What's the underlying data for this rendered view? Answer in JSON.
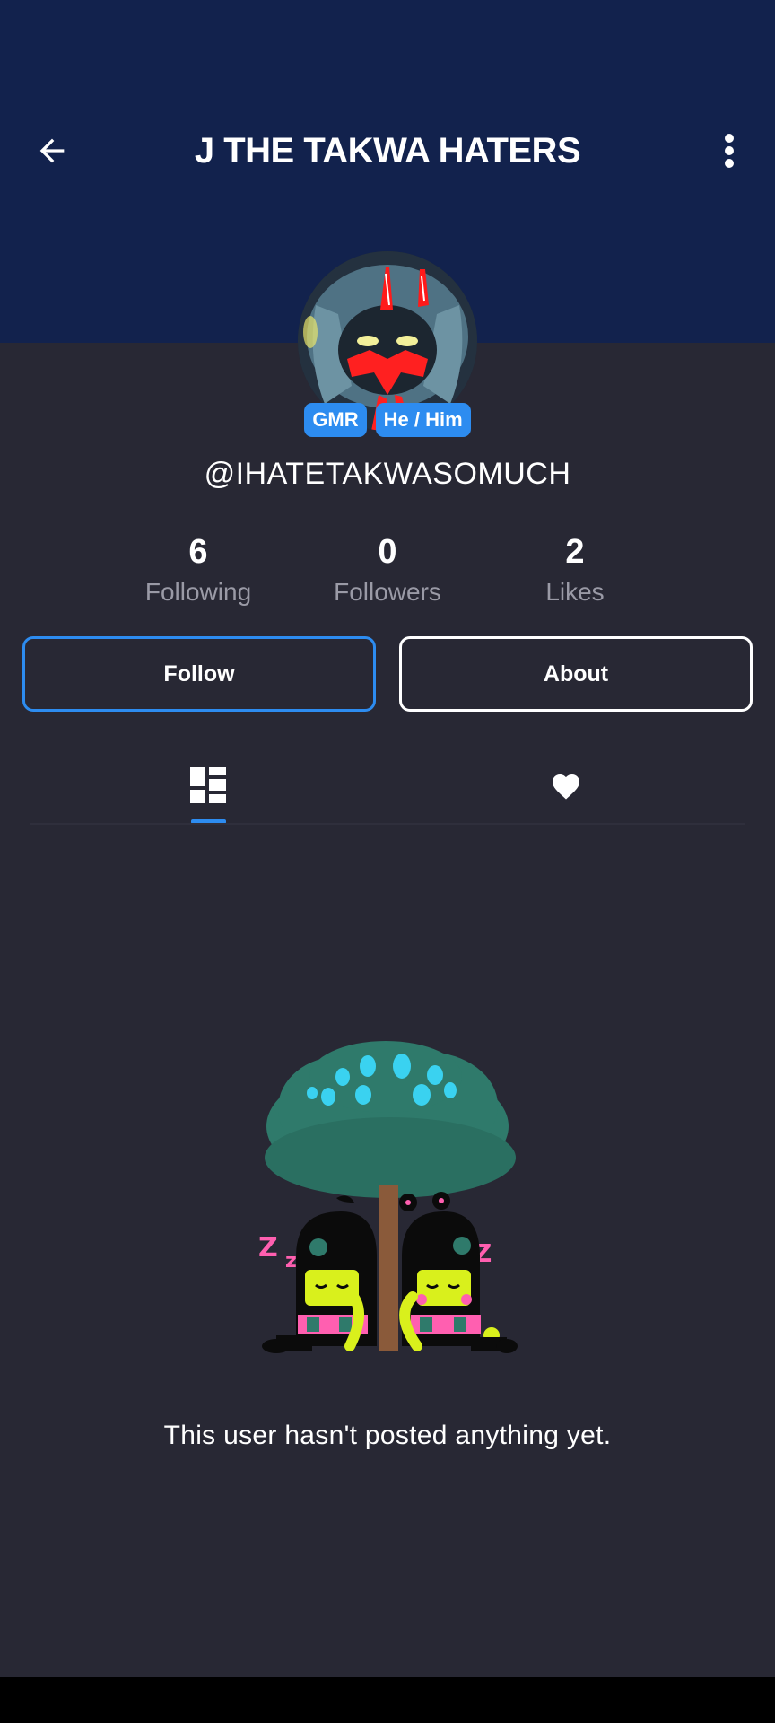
{
  "header": {
    "title": "J THE TAKWA HATERS",
    "back_icon": "arrow-left-icon",
    "more_icon": "more-vertical-icon",
    "banner_color": "#12224d"
  },
  "profile": {
    "badges": [
      "GMR",
      "He / Him"
    ],
    "handle": "@IHATETAKWASOMUCH",
    "stats": [
      {
        "value": "6",
        "label": "Following"
      },
      {
        "value": "0",
        "label": "Followers"
      },
      {
        "value": "2",
        "label": "Likes"
      }
    ]
  },
  "actions": {
    "follow_label": "Follow",
    "about_label": "About"
  },
  "tabs": [
    {
      "icon": "posts-grid-icon",
      "active": true
    },
    {
      "icon": "heart-icon",
      "active": false
    }
  ],
  "empty_state": {
    "message": "This user hasn't posted anything yet."
  },
  "colors": {
    "accent": "#2d8cf0",
    "background": "#282834"
  }
}
